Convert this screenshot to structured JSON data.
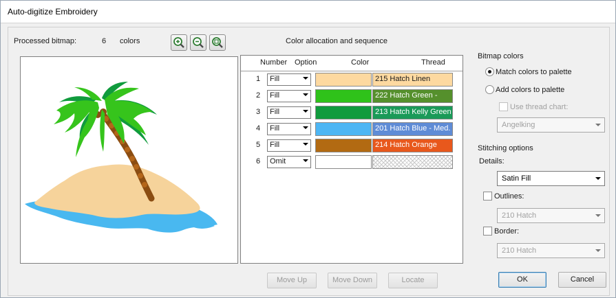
{
  "window": {
    "title": "Auto-digitize Embroidery"
  },
  "header": {
    "processed_label": "Processed bitmap:",
    "color_count": "6",
    "colors_label": "colors",
    "zoom_in_icon": "zoom-in-icon",
    "zoom_out_icon": "zoom-out-icon",
    "zoom_fit_icon": "zoom-fit-icon"
  },
  "allocation": {
    "title": "Color allocation and sequence",
    "columns": {
      "number": "Number",
      "option": "Option",
      "color": "Color",
      "thread": "Thread"
    },
    "rows": [
      {
        "number": "1",
        "option": "Fill",
        "swatch": "#fdd9a0",
        "thread": "215 Hatch Linen",
        "thread_bg": "#fdd9a0",
        "thread_fg": "#1a1a1a"
      },
      {
        "number": "2",
        "option": "Fill",
        "swatch": "#2fc21a",
        "thread": "222 Hatch Green -",
        "thread_bg": "#55902c",
        "thread_fg": "#ffffff"
      },
      {
        "number": "3",
        "option": "Fill",
        "swatch": "#109b3d",
        "thread": "213 Hatch Kelly Green",
        "thread_bg": "#1a9a58",
        "thread_fg": "#ffffff"
      },
      {
        "number": "4",
        "option": "Fill",
        "swatch": "#4db6f4",
        "thread": "201 Hatch Blue - Med.",
        "thread_bg": "#5f8cd6",
        "thread_fg": "#ffffff"
      },
      {
        "number": "5",
        "option": "Fill",
        "swatch": "#b26a12",
        "thread": "214 Hatch Orange",
        "thread_bg": "#e8581c",
        "thread_fg": "#ffffff"
      },
      {
        "number": "6",
        "option": "Omit",
        "swatch": "#ffffff",
        "thread": "",
        "thread_bg": "hatch",
        "thread_fg": "#1a1a1a"
      }
    ]
  },
  "bitmap_colors": {
    "title": "Bitmap colors",
    "match_label": "Match colors to palette",
    "add_label": "Add colors to palette",
    "use_chart_label": "Use thread chart:",
    "chart_value": "Angelking"
  },
  "stitching": {
    "title": "Stitching options",
    "details_label": "Details:",
    "details_value": "Satin Fill",
    "outlines_label": "Outlines:",
    "outlines_value": "210 Hatch",
    "border_label": "Border:",
    "border_value": "210 Hatch"
  },
  "buttons": {
    "move_up": "Move Up",
    "move_down": "Move Down",
    "locate": "Locate",
    "ok": "OK",
    "cancel": "Cancel"
  }
}
